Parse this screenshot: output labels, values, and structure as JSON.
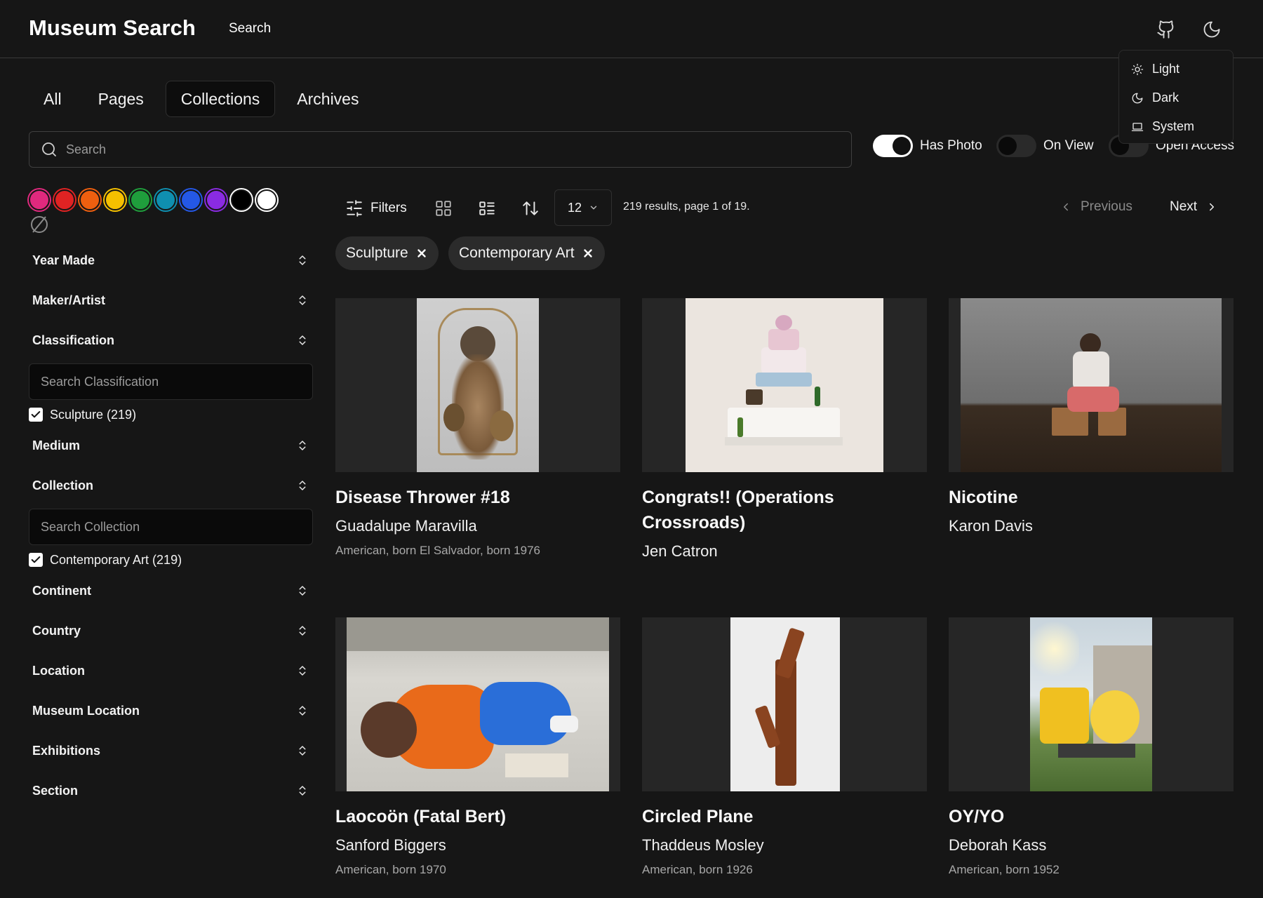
{
  "header": {
    "logo": "Museum Search",
    "nav_search": "Search",
    "github_icon": "github-icon",
    "theme_icon": "moon-icon"
  },
  "theme_menu": {
    "items": [
      {
        "label": "Light",
        "icon": "sun-icon"
      },
      {
        "label": "Dark",
        "icon": "moon-icon"
      },
      {
        "label": "System",
        "icon": "laptop-icon"
      }
    ]
  },
  "tabs": [
    {
      "label": "All",
      "active": false
    },
    {
      "label": "Pages",
      "active": false
    },
    {
      "label": "Collections",
      "active": true
    },
    {
      "label": "Archives",
      "active": false
    }
  ],
  "search": {
    "placeholder": "Search",
    "value": ""
  },
  "toggles": [
    {
      "label": "Has Photo",
      "on": true
    },
    {
      "label": "On View",
      "on": false
    },
    {
      "label": "Open Access",
      "on": false
    }
  ],
  "colors": [
    "#e0297e",
    "#e02323",
    "#ee5f0f",
    "#f5c000",
    "#1f9e3c",
    "#0f8fb0",
    "#2458e6",
    "#8a2be2",
    "#000000",
    "#ffffff"
  ],
  "facets": {
    "year_made": "Year Made",
    "maker_artist": "Maker/Artist",
    "classification": "Classification",
    "classification_search_placeholder": "Search Classification",
    "classification_checked": "Sculpture (219)",
    "medium": "Medium",
    "collection": "Collection",
    "collection_search_placeholder": "Search Collection",
    "collection_checked": "Contemporary Art (219)",
    "continent": "Continent",
    "country": "Country",
    "location": "Location",
    "museum_location": "Museum Location",
    "exhibitions": "Exhibitions",
    "section": "Section"
  },
  "toolbar": {
    "filters_label": "Filters",
    "per_page": "12",
    "results_text": "219 results, page 1 of 19.",
    "previous_label": "Previous",
    "next_label": "Next"
  },
  "chips": [
    "Sculpture",
    "Contemporary Art"
  ],
  "cards": [
    {
      "title": "Disease Thrower #18",
      "artist": "Guadalupe Maravilla",
      "meta": "American, born El Salvador, born 1976"
    },
    {
      "title": "Congrats!! (Operations Crossroads)",
      "artist": "Jen Catron",
      "meta": ""
    },
    {
      "title": "Nicotine",
      "artist": "Karon Davis",
      "meta": ""
    },
    {
      "title": "Laocoön (Fatal Bert)",
      "artist": "Sanford Biggers",
      "meta": "American, born 1970"
    },
    {
      "title": "Circled Plane",
      "artist": "Thaddeus Mosley",
      "meta": "American, born 1926"
    },
    {
      "title": "OY/YO",
      "artist": "Deborah Kass",
      "meta": "American, born 1952"
    }
  ]
}
